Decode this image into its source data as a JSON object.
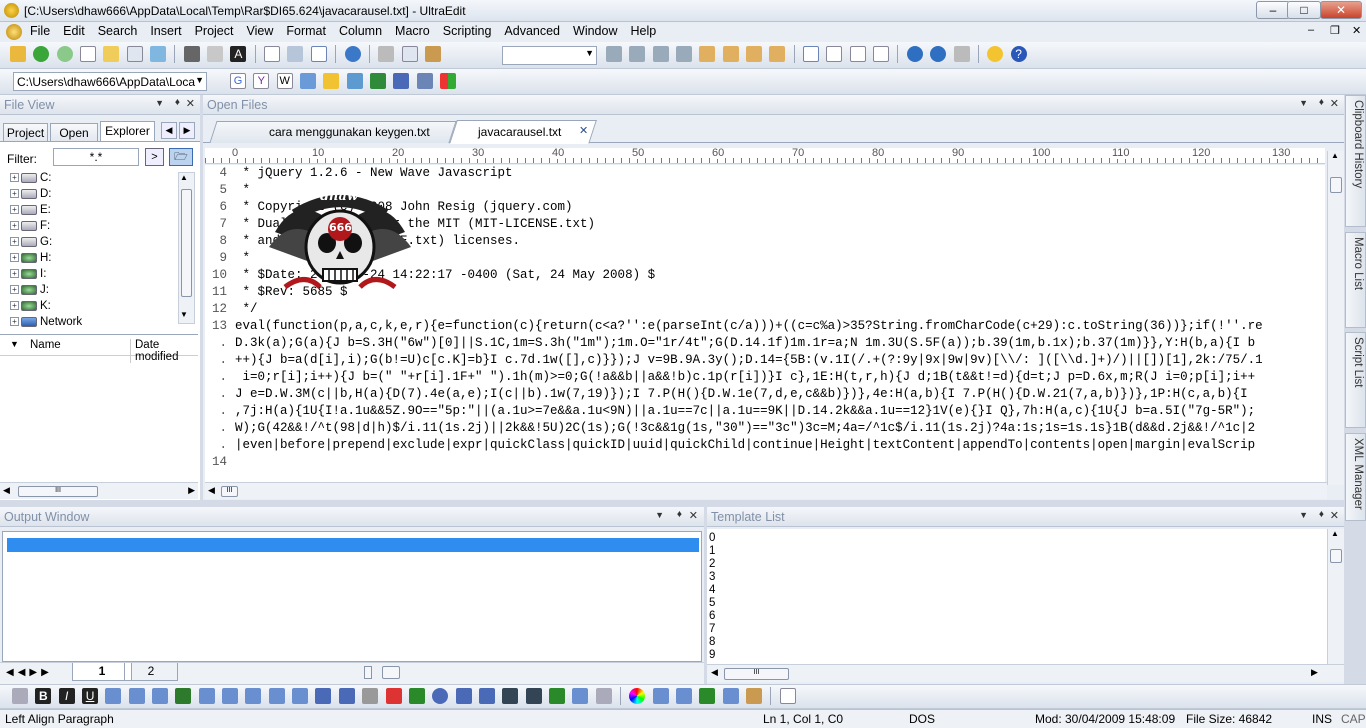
{
  "window": {
    "title": "[C:\\Users\\dhaw666\\AppData\\Local\\Temp\\Rar$DI65.624\\javacarausel.txt] - UltraEdit"
  },
  "menu": [
    "File",
    "Edit",
    "Search",
    "Insert",
    "Project",
    "View",
    "Format",
    "Column",
    "Macro",
    "Scripting",
    "Advanced",
    "Window",
    "Help"
  ],
  "toolbar2": {
    "path_value": "C:\\Users\\dhaw666\\AppData\\Loca"
  },
  "file_view": {
    "title": "File View",
    "tabs": [
      "Project",
      "Open",
      "Explorer"
    ],
    "filter_label": "Filter:",
    "filter_value": "*.*",
    "drives": [
      "C:",
      "D:",
      "E:",
      "F:",
      "G:",
      "H:",
      "I:",
      "J:",
      "K:",
      "Network"
    ],
    "columns": [
      "Name",
      "Date modified"
    ]
  },
  "open_files": {
    "title": "Open Files",
    "tabs": [
      "cara menggunakan keygen.txt",
      "javacarausel.txt"
    ]
  },
  "ruler": {
    "marks": [
      "0",
      "10",
      "20",
      "30",
      "40",
      "50",
      "60",
      "70",
      "80",
      "90",
      "100",
      "110",
      "120",
      "130"
    ]
  },
  "editor": {
    "lines": [
      {
        "num": "4",
        "text": " * jQuery 1.2.6 - New Wave Javascript"
      },
      {
        "num": "5",
        "text": " *"
      },
      {
        "num": "6",
        "text": " * Copyright (c) 2008 John Resig (jquery.com)"
      },
      {
        "num": "7",
        "text": " * Dual licensed under the MIT (MIT-LICENSE.txt)"
      },
      {
        "num": "8",
        "text": " * and GPL (GPL-LICENSE.txt) licenses."
      },
      {
        "num": "9",
        "text": " *"
      },
      {
        "num": "10",
        "text": " * $Date: 2008-05-24 14:22:17 -0400 (Sat, 24 May 2008) $"
      },
      {
        "num": "11",
        "text": " * $Rev: 5685 $"
      },
      {
        "num": "12",
        "text": " */"
      },
      {
        "num": "13",
        "text": "eval(function(p,a,c,k,e,r){e=function(c){return(c<a?'':e(parseInt(c/a)))+((c=c%a)>35?String.fromCharCode(c+29):c.toString(36))};if(!''.re"
      },
      {
        "num": ".",
        "text": "D.3k(a);G(a){J b=S.3H(\"6w\")[0]||S.1C,1m=S.3h(\"1m\");1m.O=\"1r/4t\";G(D.14.1f)1m.1r=a;N 1m.3U(S.5F(a));b.39(1m,b.1x);b.37(1m)}},Y:H(b,a){I b"
      },
      {
        "num": ".",
        "text": "++){J b=a(d[i],i);G(b!=U)c[c.K]=b}I c.7d.1w([],c)}});J v=9B.9A.3y();D.14={5B:(v.1I(/.+(?:9y|9x|9w|9v)[\\\\/: ]([\\\\d.]+)/)||[])[1],2k:/75/.1"
      },
      {
        "num": ".",
        "text": " i=0;r[i];i++){J b=(\" \"+r[i].1F+\" \").1h(m)>=0;G(!a&&b||a&&!b)c.1p(r[i])}I c},1E:H(t,r,h){J d;1B(t&&t!=d){d=t;J p=D.6x,m;R(J i=0;p[i];i++"
      },
      {
        "num": ".",
        "text": "J e=D.W.3M(c||b,H(a){D(7).4e(a,e);I(c||b).1w(7,19)});I 7.P(H(){D.W.1e(7,d,e,c&&b)})},4e:H(a,b){I 7.P(H(){D.W.21(7,a,b)})},1P:H(c,a,b){I "
      },
      {
        "num": ".",
        "text": ",7j:H(a){1U{I!a.1u&&5Z.9O==\"5p:\"||(a.1u>=7e&&a.1u<9N)||a.1u==7c||a.1u==9K||D.14.2k&&a.1u==12}1V(e){}I Q},7h:H(a,c){1U{J b=a.5I(\"7g-5R\");"
      },
      {
        "num": ".",
        "text": "W);G(42&&!/^t(98|d|h)$/i.11(1s.2j)||2k&&!5U)2C(1s);G(!3c&&1g(1s,\"30\")==\"3c\")3c=M;4a=/^1c$/i.11(1s.2j)?4a:1s;1s=1s.1s}1B(d&&d.2j&&!/^1c|2"
      },
      {
        "num": ".",
        "text": "|even|before|prepend|exclude|expr|quickClass|quickID|uuid|quickChild|continue|Height|textContent|appendTo|contents|open|margin|evalScrip"
      },
      {
        "num": "14",
        "text": ""
      }
    ]
  },
  "logo": {
    "text_top": "dhaw",
    "text_mid": "666"
  },
  "output_window": {
    "title": "Output Window",
    "tabs": [
      "1",
      "2"
    ]
  },
  "template_list": {
    "title": "Template List",
    "items": [
      "0",
      "1",
      "2",
      "3",
      "4",
      "5",
      "6",
      "7",
      "8",
      "9"
    ]
  },
  "side_tabs": [
    "Clipboard History",
    "Macro List",
    "Script List",
    "XML Manager"
  ],
  "statusbar": {
    "hint": "Left Align Paragraph",
    "position": "Ln 1, Col 1, C0",
    "line_ending": "DOS",
    "modified": "Mod: 30/04/2009 15:48:09",
    "file_size": "File Size: 46842",
    "ins": "INS",
    "caps": "CAP"
  },
  "colors": {
    "accent": "#2f8df0",
    "active_tab": "#ffffff"
  }
}
